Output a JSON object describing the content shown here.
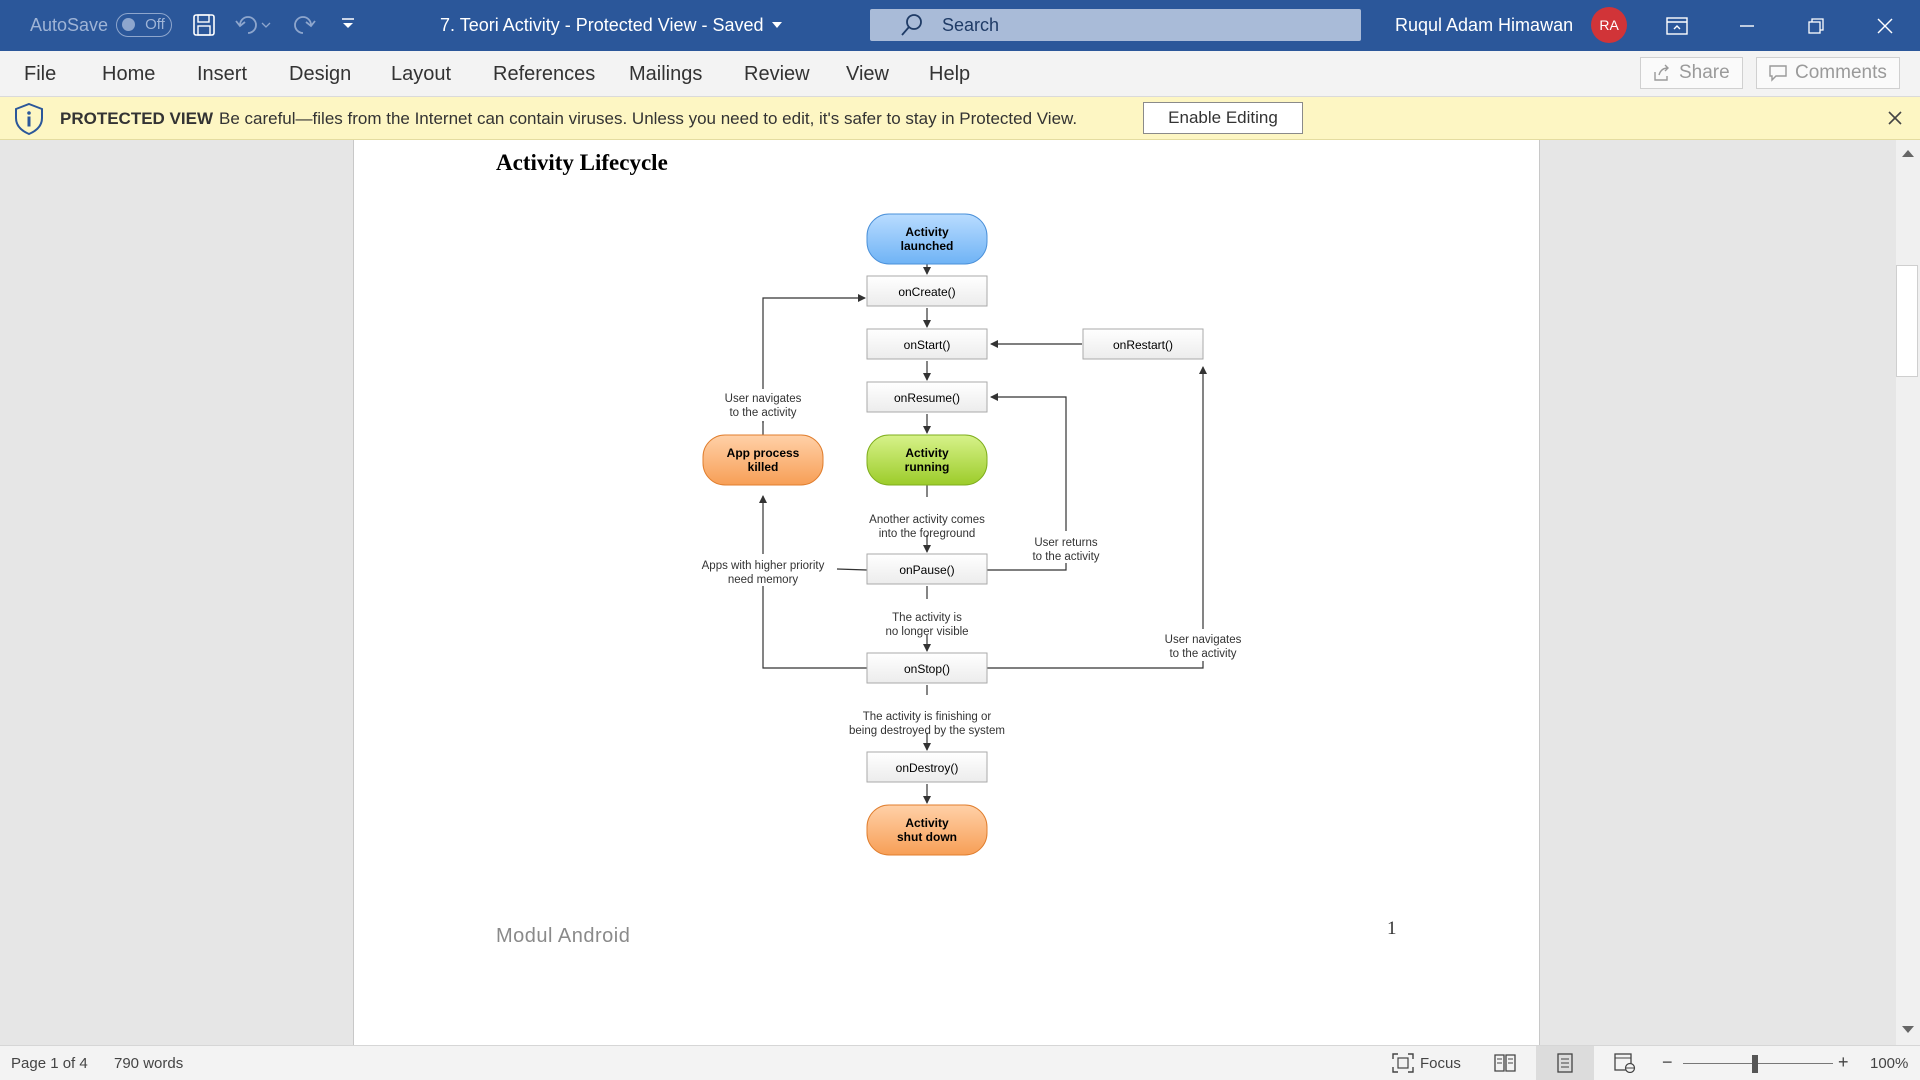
{
  "titlebar": {
    "autosave_label": "AutoSave",
    "autosave_state": "Off",
    "doc_title": "7. Teori Activity  -  Protected View  -  Saved",
    "search_placeholder": "Search",
    "user_name": "Ruqul Adam Himawan",
    "user_initials": "RA",
    "accent": "#2b579a"
  },
  "menu": {
    "items": [
      "File",
      "Home",
      "Insert",
      "Design",
      "Layout",
      "References",
      "Mailings",
      "Review",
      "View",
      "Help"
    ],
    "share": "Share",
    "comments": "Comments"
  },
  "protected_view": {
    "title": "PROTECTED VIEW",
    "message": "Be careful—files from the Internet can contain viruses. Unless you need to edit, it's safer to stay in Protected View.",
    "enable_button": "Enable Editing"
  },
  "document": {
    "heading": "Activity Lifecycle",
    "footer": "Modul Android",
    "page_number": "1",
    "diagram": {
      "nodes": {
        "launched": [
          "Activity",
          "launched"
        ],
        "oncreate": "onCreate()",
        "onstart": "onStart()",
        "onrestart": "onRestart()",
        "onresume": "onResume()",
        "running": [
          "Activity",
          "running"
        ],
        "killed": [
          "App process",
          "killed"
        ],
        "onpause": "onPause()",
        "onstop": "onStop()",
        "ondestroy": "onDestroy()",
        "shutdown": [
          "Activity",
          "shut down"
        ]
      },
      "labels": {
        "user_nav_left": [
          "User navigates",
          "to the activity"
        ],
        "another_activity": [
          "Another activity comes",
          "into the foreground"
        ],
        "user_returns": [
          "User returns",
          "to the activity"
        ],
        "higher_priority": [
          "Apps with higher priority",
          "need memory"
        ],
        "no_longer_visible": [
          "The activity is",
          "no longer visible"
        ],
        "user_nav_right": [
          "User navigates",
          "to the activity"
        ],
        "finishing": [
          "The activity is finishing or",
          "being destroyed by the system"
        ]
      }
    }
  },
  "status": {
    "page": "Page 1 of 4",
    "words": "790 words",
    "focus": "Focus",
    "zoom": "100%"
  }
}
